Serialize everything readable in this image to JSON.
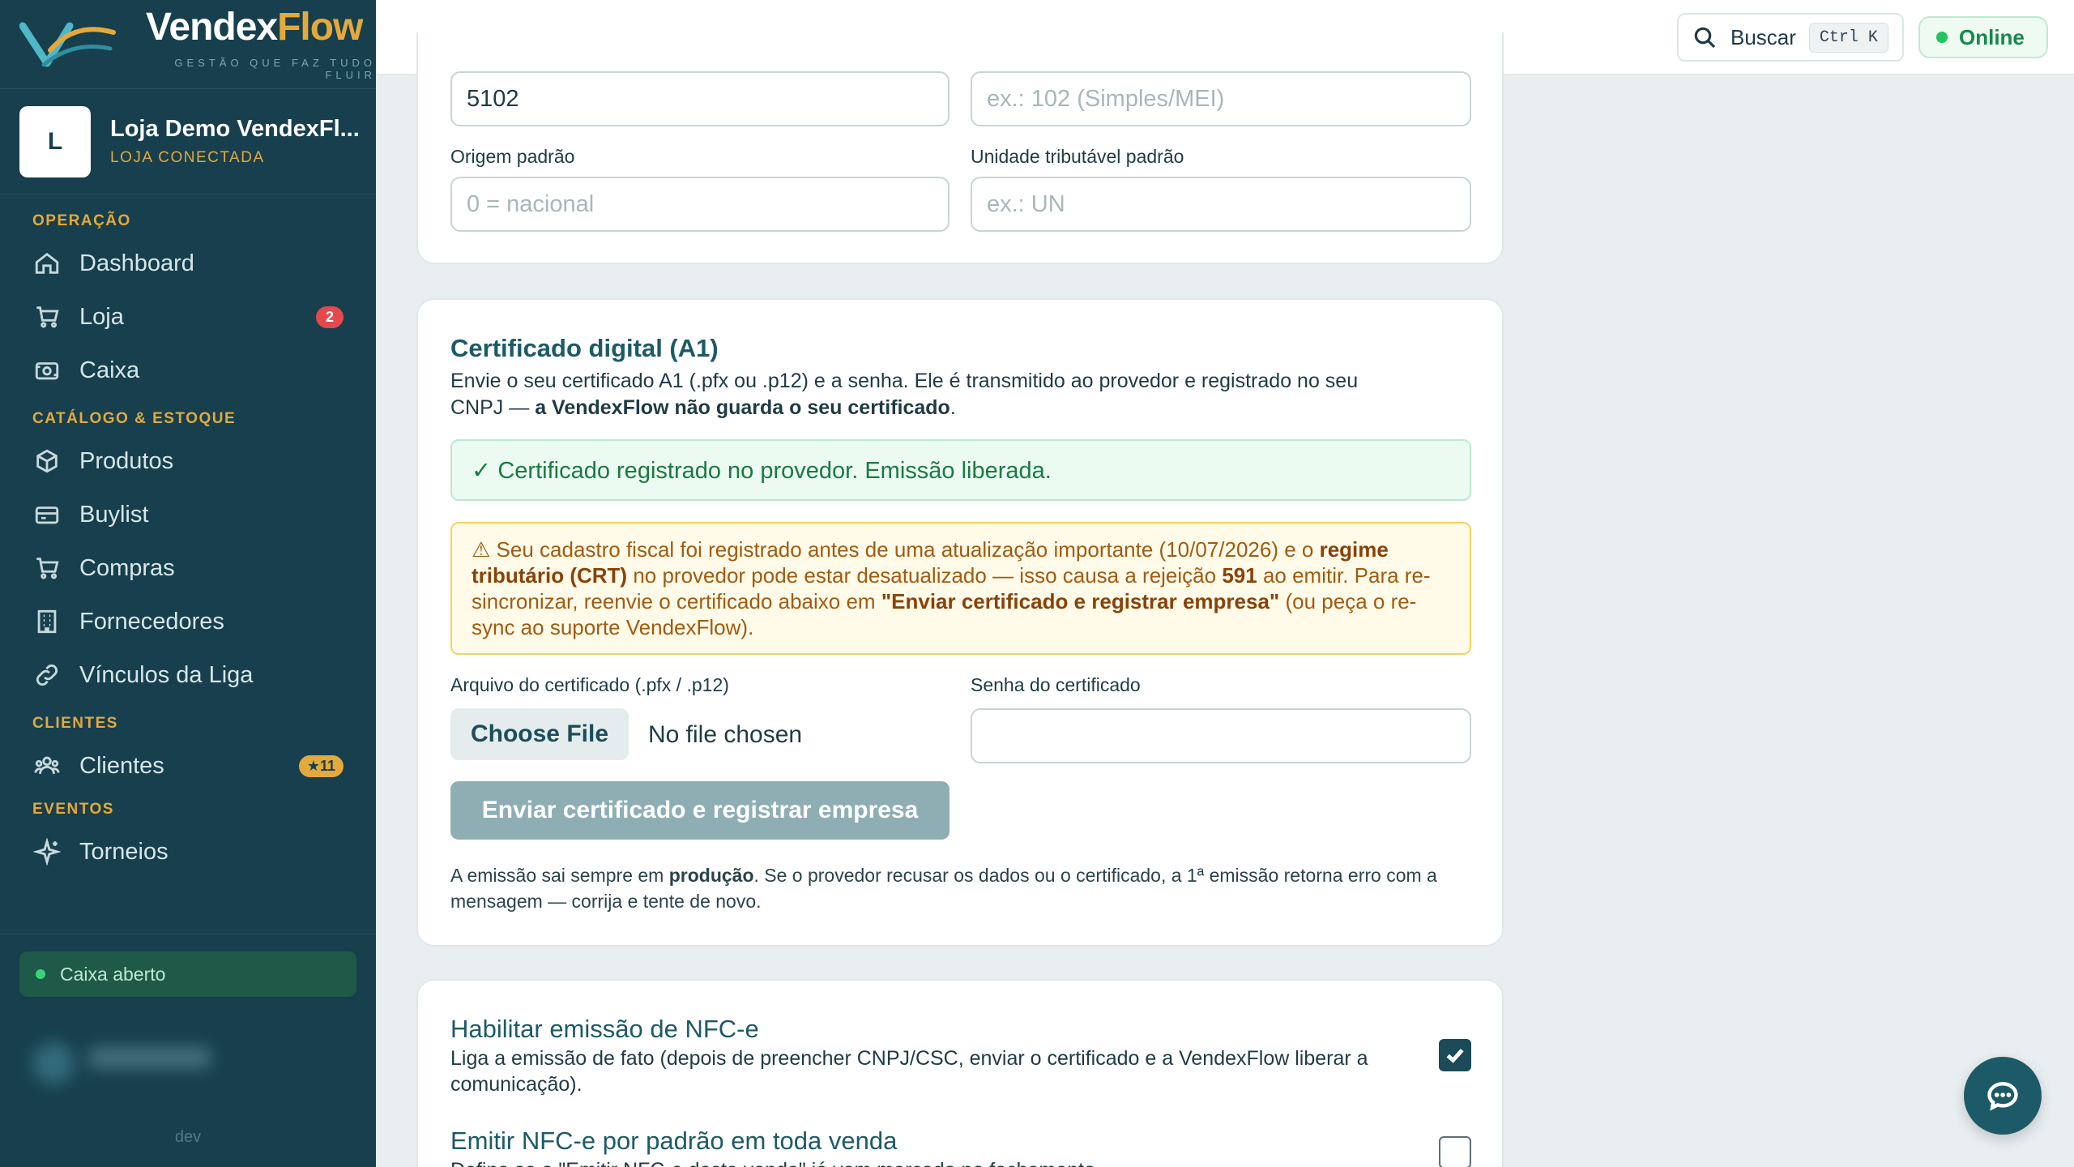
{
  "brand": {
    "name_part1": "Vendex",
    "name_part2": "Flow",
    "tagline": "GESTÃO QUE FAZ TUDO FLUIR"
  },
  "store": {
    "initial": "L",
    "name": "Loja Demo VendexFl...",
    "status": "LOJA CONECTADA"
  },
  "nav": {
    "sections": [
      {
        "title": "OPERAÇÃO"
      },
      {
        "title": "CATÁLOGO & ESTOQUE"
      },
      {
        "title": "CLIENTES"
      },
      {
        "title": "EVENTOS"
      }
    ],
    "items": [
      {
        "label": "Dashboard",
        "icon": "home-icon"
      },
      {
        "label": "Loja",
        "icon": "cart-icon",
        "badge": "2"
      },
      {
        "label": "Caixa",
        "icon": "cash-register-icon"
      },
      {
        "label": "Produtos",
        "icon": "box-icon"
      },
      {
        "label": "Buylist",
        "icon": "card-icon"
      },
      {
        "label": "Compras",
        "icon": "cart-icon"
      },
      {
        "label": "Fornecedores",
        "icon": "building-icon"
      },
      {
        "label": "Vínculos da Liga",
        "icon": "link-icon"
      },
      {
        "label": "Clientes",
        "icon": "users-icon",
        "badge": "★11"
      },
      {
        "label": "Torneios",
        "icon": "sparkle-icon"
      }
    ]
  },
  "caixa_status": "Caixa aberto",
  "footer_env": "dev",
  "topbar": {
    "search_label": "Buscar",
    "search_shortcut": "Ctrl K",
    "status": "Online"
  },
  "fiscal": {
    "cfop_value": "5102",
    "csosn_placeholder": "ex.: 102 (Simples/MEI)",
    "origem_label": "Origem padrão",
    "origem_placeholder": "0 = nacional",
    "unidade_label": "Unidade tributável padrão",
    "unidade_placeholder": "ex.: UN"
  },
  "certificate": {
    "title": "Certificado digital (A1)",
    "desc_line1": "Envie o seu certificado A1 (.pfx ou .p12) e a senha. Ele é transmitido ao provedor e registrado no seu",
    "desc_line2_prefix": "CNPJ — ",
    "desc_line2_bold": "a VendexFlow não guarda o seu certificado",
    "desc_line2_suffix": ".",
    "success": "✓ Certificado registrado no provedor. Emissão liberada.",
    "warning": {
      "p1": "⚠ Seu cadastro fiscal foi registrado antes de uma atualização importante (10/07/2026) e o ",
      "b1": "regime tributário (CRT)",
      "p2": " no provedor pode estar desatualizado — isso causa a rejeição ",
      "b2": "591",
      "p3": " ao emitir. Para re-sincronizar, reenvie o certificado abaixo em ",
      "b3": "\"Enviar certificado e registrar empresa\"",
      "p4": " (ou peça o re-sync ao suporte VendexFlow)."
    },
    "file_label": "Arquivo do certificado (.pfx / .p12)",
    "file_button": "Choose File",
    "file_none": "No file chosen",
    "password_label": "Senha do certificado",
    "password_value": "",
    "submit": "Enviar certificado e registrar empresa",
    "note_prefix": "A emissão sai sempre em ",
    "note_bold": "produção",
    "note_suffix": ". Se o provedor recusar os dados ou o certificado, a 1ª emissão retorna erro com a mensagem — corrija e tente de novo."
  },
  "nfce": {
    "enable_title": "Habilitar emissão de NFC-e",
    "enable_desc": "Liga a emissão de fato (depois de preencher CNPJ/CSC, enviar o certificado e a VendexFlow liberar a comunicação).",
    "enable_checked": true,
    "default_title": "Emitir NFC-e por padrão em toda venda",
    "default_desc": "Define se o \"Emitir NFC-e desta venda\" já vem marcado no fechamento.",
    "default_checked": false
  },
  "colors": {
    "sidebar": "#173f4d",
    "accent": "#e4a93c",
    "primary": "#1d5a67",
    "success": "#1b7a43",
    "warning": "#a35a10"
  }
}
